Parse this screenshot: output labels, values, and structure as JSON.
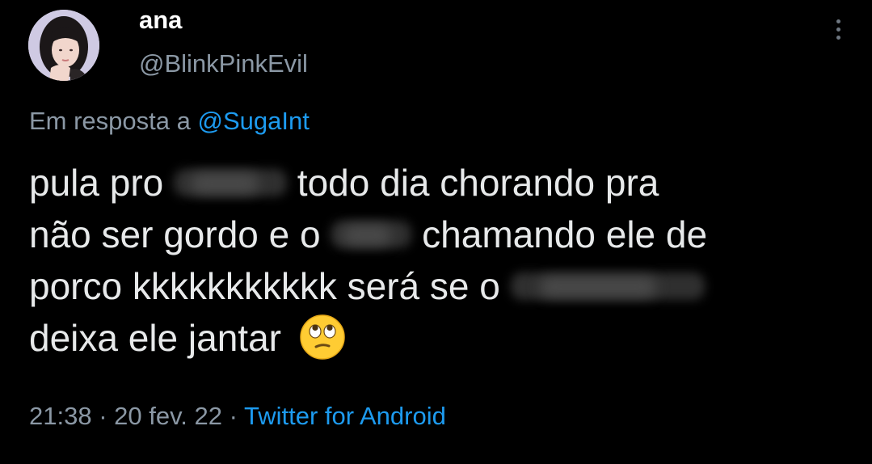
{
  "tweet": {
    "author_name": "ana",
    "author_handle": "@BlinkPinkEvil",
    "reply_prefix": "Em resposta a ",
    "reply_to": "@SugaInt",
    "text_lines": [
      {
        "before": "pula pro ",
        "after": " todo dia chorando pra"
      },
      {
        "before": "não ser gordo e o ",
        "after": " chamando ele de"
      },
      {
        "before": "porco kkkkkkkkkkk será se o ",
        "after": ""
      },
      {
        "before": "deixa ele jantar ",
        "after": ""
      }
    ],
    "time": "21:38",
    "separator": " · ",
    "date": "20 fev. 22",
    "source": "Twitter for Android"
  },
  "icons": {
    "more": "more-vertical-icon",
    "emoji": "face-with-rolling-eyes-icon"
  },
  "colors": {
    "background": "#000000",
    "primary_text": "#e7e9ea",
    "secondary_text": "#8b98a5",
    "link": "#1d9bf0"
  }
}
